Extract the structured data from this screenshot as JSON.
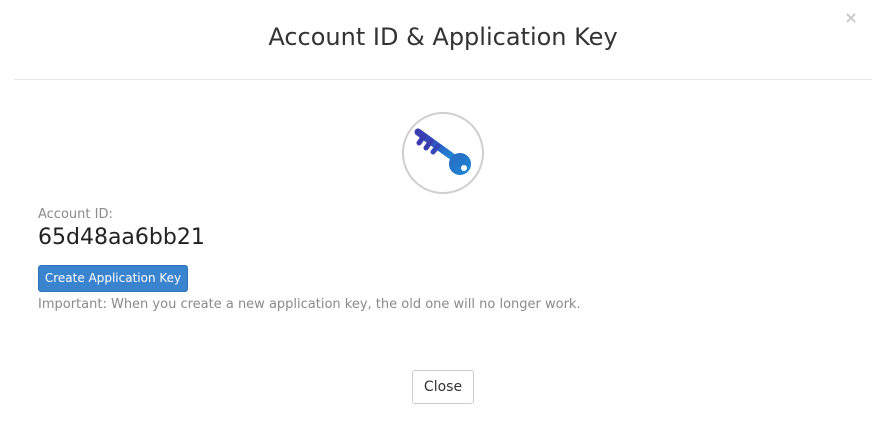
{
  "dialog": {
    "title": "Account ID & Application Key",
    "close_icon": "×"
  },
  "icon": {
    "name": "key-icon",
    "colors": {
      "key_dark": "#3a3db0",
      "key_light": "#1f8fd6",
      "circle_border": "#cfcfcf"
    }
  },
  "account": {
    "label": "Account ID:",
    "value": "65d48aa6bb21"
  },
  "actions": {
    "create_label": "Create Application Key",
    "important_note": "Important: When you create a new application key, the old one will no longer work.",
    "close_label": "Close"
  },
  "colors": {
    "primary_button": "#3a84cf",
    "muted_text": "#8a8a8a"
  }
}
